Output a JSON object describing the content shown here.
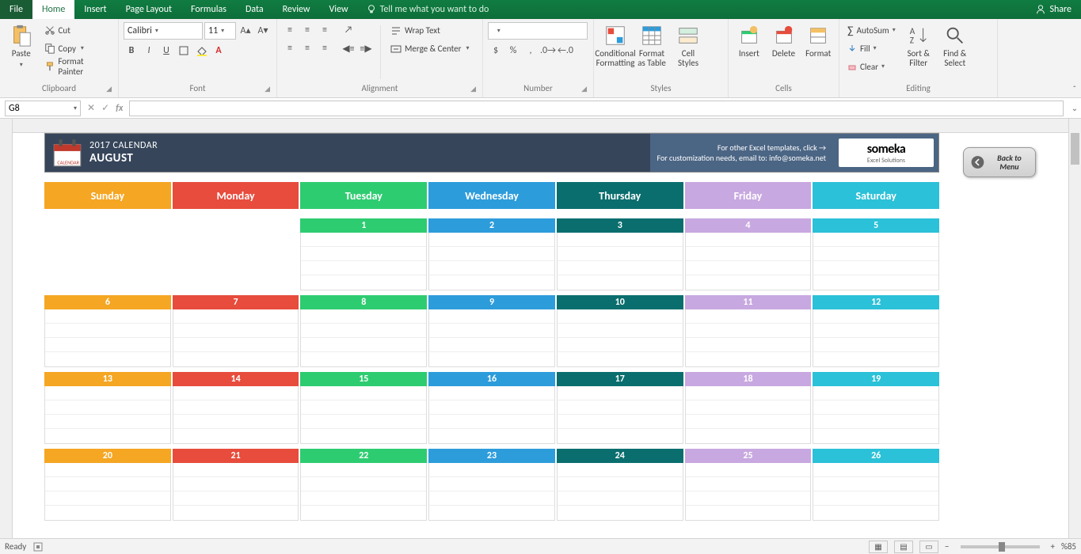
{
  "menu": {
    "file": "File",
    "home": "Home",
    "insert": "Insert",
    "page": "Page Layout",
    "formulas": "Formulas",
    "data": "Data",
    "review": "Review",
    "view": "View",
    "tell": "Tell me what you want to do",
    "share": "Share"
  },
  "ribbon": {
    "paste": "Paste",
    "cut": "Cut",
    "copy": "Copy",
    "painter": "Format Painter",
    "clipboard": "Clipboard",
    "font_name": "Calibri",
    "font_size": "11",
    "font_group": "Font",
    "wrap": "Wrap Text",
    "merge": "Merge & Center",
    "align": "Alignment",
    "number": "Number",
    "cond": "Conditional Formatting",
    "fmt_as": "Format as Table",
    "cell_styles": "Cell Styles",
    "styles": "Styles",
    "insert": "Insert",
    "delete": "Delete",
    "format": "Format",
    "cells": "Cells",
    "autosum": "AutoSum",
    "fill": "Fill",
    "clear": "Clear",
    "sort": "Sort & Filter",
    "find": "Find & Select",
    "editing": "Editing"
  },
  "fx": {
    "cell": "G8"
  },
  "calendar": {
    "year": "2017 CALENDAR",
    "month": "AUGUST",
    "msg1": "For other Excel templates, click →",
    "msg2": "For customization needs, email to: info@someka.net",
    "logo": "someka",
    "logo_sub": "Excel Solutions",
    "back": "Back to Menu",
    "days": [
      "Sunday",
      "Monday",
      "Tuesday",
      "Wednesday",
      "Thursday",
      "Friday",
      "Saturday"
    ],
    "day_colors": [
      "c-sun",
      "c-mon",
      "c-tue",
      "c-wed",
      "c-thu",
      "c-fri",
      "c-sat"
    ],
    "weeks": [
      [
        null,
        null,
        1,
        2,
        3,
        4,
        5
      ],
      [
        6,
        7,
        8,
        9,
        10,
        11,
        12
      ],
      [
        13,
        14,
        15,
        16,
        17,
        18,
        19
      ],
      [
        20,
        21,
        22,
        23,
        24,
        25,
        26
      ]
    ]
  },
  "status": {
    "ready": "Ready",
    "zoom": "%85"
  }
}
